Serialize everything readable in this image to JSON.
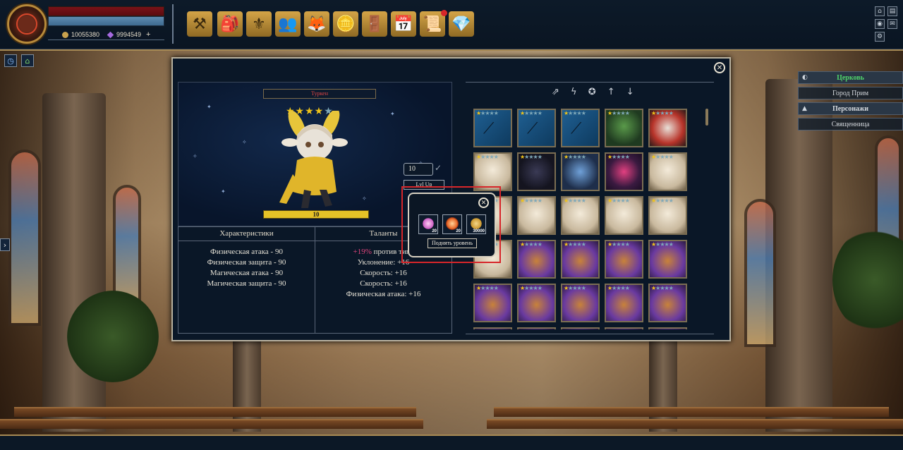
{
  "player": {
    "gold": "10055380",
    "gems": "9994549",
    "add_symbol": "+"
  },
  "top_menu": [
    {
      "name": "forge-icon",
      "glyph": "⚒"
    },
    {
      "name": "backpack-icon",
      "glyph": "🎒"
    },
    {
      "name": "guild-icon",
      "glyph": "⚜"
    },
    {
      "name": "friends-icon",
      "glyph": "👥"
    },
    {
      "name": "pet-icon",
      "glyph": "🦊"
    },
    {
      "name": "coins-icon",
      "glyph": "🪙"
    },
    {
      "name": "door-icon",
      "glyph": "🚪"
    },
    {
      "name": "calendar-icon",
      "glyph": "📅"
    },
    {
      "name": "quest-book-icon",
      "glyph": "📜"
    },
    {
      "name": "diamond-icon",
      "glyph": "💎"
    }
  ],
  "system_buttons": {
    "home": "⌂",
    "chat": "▤",
    "screenshot": "◉",
    "mail": "✉",
    "settings": "⚙"
  },
  "left_buttons": {
    "clock": "◷",
    "home": "⌂",
    "expand": "›"
  },
  "right_nav": [
    {
      "label": "Церковь",
      "type": "head",
      "color": "#4fd36a",
      "icon": "◐"
    },
    {
      "label": "Город Прим",
      "type": "item"
    },
    {
      "label": "Персонажи",
      "type": "head",
      "color": "#d5d9de",
      "icon": "▲"
    },
    {
      "label": "Священница",
      "type": "item"
    }
  ],
  "hero": {
    "name": "Туркен",
    "stars_filled": "★★★★",
    "stars_empty": "★",
    "level": "10",
    "level_input": "10",
    "lvl_up_button": "Lvl Up"
  },
  "stats": {
    "tab_characteristics": "Характеристики",
    "tab_talents": "Таланты",
    "characteristics": [
      "Физическая атака - 90",
      "Физическая защита - 90",
      "Магическая атака - 90",
      "Магическая защита - 90"
    ],
    "talent_first_highlight": "+19%",
    "talent_first_rest": " против типа",
    "talents": [
      "Уклонение: +16",
      "Скорость: +16",
      "Скорость: +16",
      "Физическая атака: +16"
    ]
  },
  "sort_bar": "⇗ ϟ ✪   ↑ ↓",
  "level_up_popup": {
    "items": [
      {
        "name": "pink-crystal",
        "quantity": "20",
        "color": "#e58ad8"
      },
      {
        "name": "fire-orb",
        "quantity": "20",
        "color": "#e86a2a"
      },
      {
        "name": "gold-coin",
        "quantity": "30000",
        "color": "#d4a447"
      }
    ],
    "button": "Поднять уровень"
  },
  "colors": {
    "accent_gold": "#d4a447",
    "star_gold": "#f0c419",
    "star_empty": "#7fa8b8",
    "highlight_red": "#d7262a"
  }
}
